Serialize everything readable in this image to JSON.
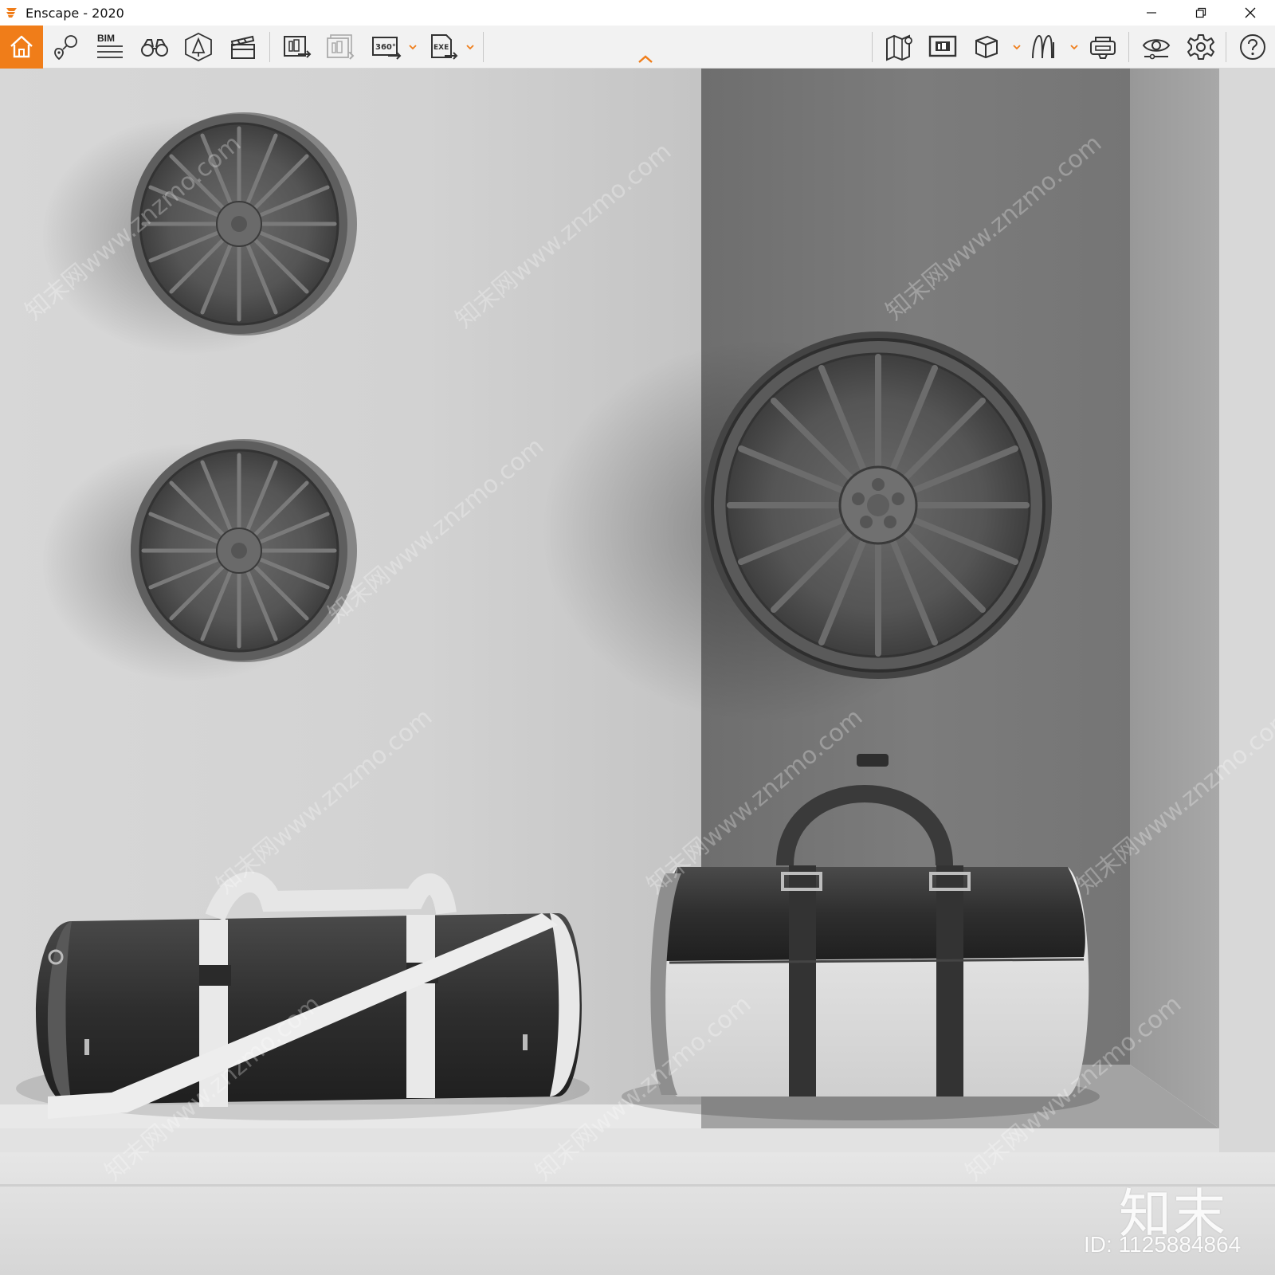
{
  "window": {
    "title": "Enscape - 2020",
    "accent_color": "#f07d19"
  },
  "toolbar": {
    "left_items": [
      {
        "name": "home",
        "icon": "home-icon"
      },
      {
        "name": "views",
        "icon": "location-pin-icon"
      },
      {
        "name": "bim",
        "icon": "bim-icon",
        "label": "BIM"
      },
      {
        "name": "walk-mode",
        "icon": "binoculars-icon"
      },
      {
        "name": "asset-library",
        "icon": "asset-library-icon"
      },
      {
        "name": "video-editor",
        "icon": "clapperboard-icon"
      },
      {
        "name": "render-image",
        "icon": "render-image-icon"
      },
      {
        "name": "batch-render",
        "icon": "batch-render-icon"
      },
      {
        "name": "panorama",
        "icon": "panorama-360-icon",
        "label": "360°"
      },
      {
        "name": "export-exe",
        "icon": "export-exe-icon",
        "label": "EXE"
      }
    ],
    "right_items": [
      {
        "name": "map",
        "icon": "map-icon"
      },
      {
        "name": "capture-view",
        "icon": "screen-capture-icon"
      },
      {
        "name": "cube-view",
        "icon": "cube-icon"
      },
      {
        "name": "material-editor",
        "icon": "material-editor-icon"
      },
      {
        "name": "vr-headset",
        "icon": "vr-headset-icon"
      },
      {
        "name": "visual-settings",
        "icon": "eye-icon"
      },
      {
        "name": "general-settings",
        "icon": "gear-icon"
      },
      {
        "name": "help",
        "icon": "help-icon"
      }
    ]
  },
  "scene": {
    "objects": [
      "wheel-rim-top-left",
      "wheel-rim-middle-left",
      "wheel-rim-large-right",
      "duffel-bag-left",
      "duffel-bag-right"
    ]
  },
  "watermark": {
    "logo_text": "知末",
    "id_text": "ID: 1125884864",
    "repeat_text": "知末网www.znzmo.com"
  }
}
